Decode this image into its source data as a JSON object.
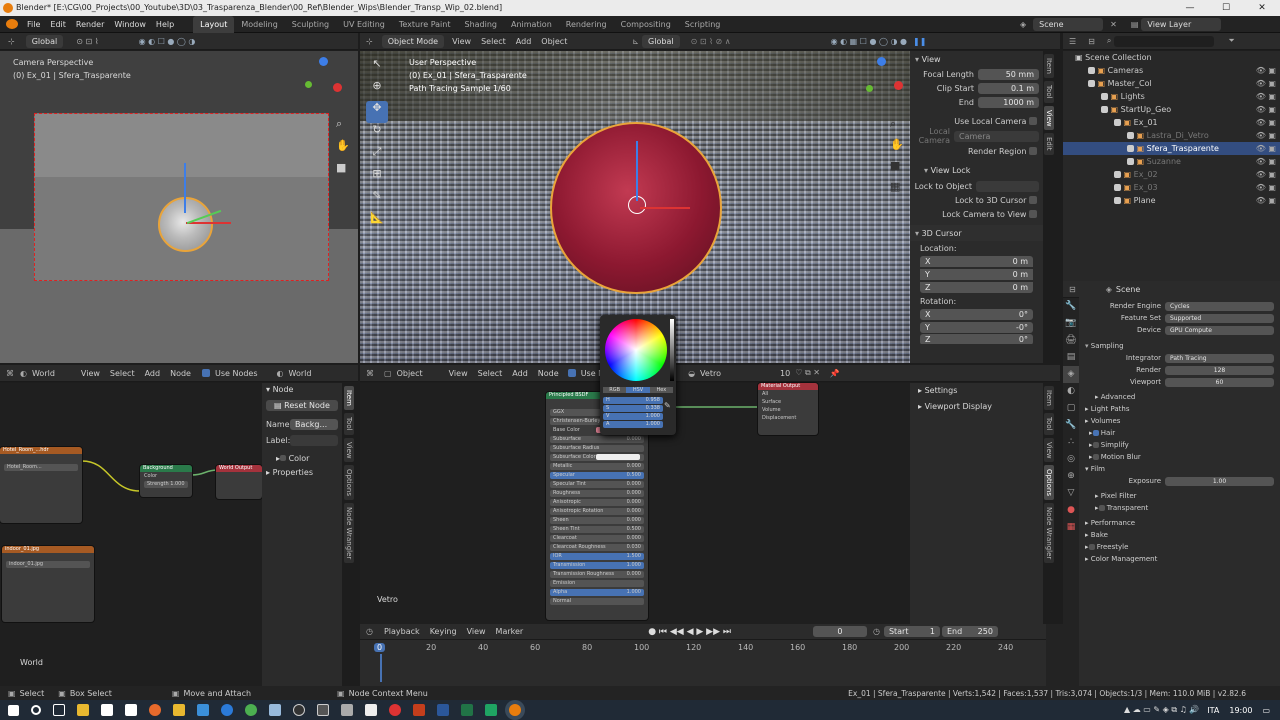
{
  "window": {
    "title": "Blender* [E:\\CG\\00_Projects\\00_Youtube\\3D\\03_Trasparenza_Blender\\00_Ref\\Blender_Wips\\Blender_Transp_Wip_02.blend]",
    "min": "—",
    "max": "☐",
    "close": "✕"
  },
  "menu": [
    "File",
    "Edit",
    "Render",
    "Window",
    "Help"
  ],
  "workspaces": [
    "Layout",
    "Modeling",
    "Sculpting",
    "UV Editing",
    "Texture Paint",
    "Shading",
    "Animation",
    "Rendering",
    "Compositing",
    "Scripting"
  ],
  "scene": {
    "label": "Scene",
    "view_layer": "View Layer"
  },
  "left_vp": {
    "orientation": "Global",
    "line1": "Camera Perspective",
    "line2": "(0) Ex_01 | Sfera_Trasparente"
  },
  "main_vp": {
    "mode": "Object Mode",
    "view": "View",
    "select": "Select",
    "add": "Add",
    "object": "Object",
    "orientation": "Global",
    "line1": "User Perspective",
    "line2": "(0) Ex_01 | Sfera_Trasparente",
    "line3": "Path Tracing Sample 1/60"
  },
  "nsidebar": {
    "view_title": "View",
    "focal_label": "Focal Length",
    "focal": "50 mm",
    "clip_start_label": "Clip Start",
    "clip_start": "0.1 m",
    "end_label": "End",
    "end": "1000 m",
    "local_cam": "Use Local Camera",
    "local_camera": "Local Camera",
    "camera": "Camera",
    "render_region": "Render Region",
    "view_lock": "View Lock",
    "lock_obj": "Lock to Object",
    "lock_cursor": "Lock to 3D Cursor",
    "lock_cam": "Lock Camera to View",
    "cursor_title": "3D Cursor",
    "location": "Location:",
    "x": "X",
    "y": "Y",
    "z": "Z",
    "loc_x": "0 m",
    "loc_y": "0 m",
    "loc_z": "0 m",
    "rotation": "Rotation:",
    "rot_x": "0°",
    "rot_y": "-0°",
    "rot_z": "0°"
  },
  "vtabs_main": [
    "Item",
    "Tool",
    "View",
    "Edit"
  ],
  "outliner": {
    "title": "Scene Collection",
    "items": [
      {
        "name": "Cameras",
        "indent": 1,
        "dim": false,
        "hl": false
      },
      {
        "name": "Master_Col",
        "indent": 1,
        "dim": false,
        "hl": false
      },
      {
        "name": "Lights",
        "indent": 2,
        "dim": false,
        "hl": false
      },
      {
        "name": "StartUp_Geo",
        "indent": 2,
        "dim": false,
        "hl": false
      },
      {
        "name": "Ex_01",
        "indent": 3,
        "dim": false,
        "hl": false
      },
      {
        "name": "Lastra_Di_Vetro",
        "indent": 4,
        "dim": true,
        "hl": false
      },
      {
        "name": "Sfera_Trasparente",
        "indent": 4,
        "dim": false,
        "hl": true
      },
      {
        "name": "Suzanne",
        "indent": 4,
        "dim": true,
        "hl": false
      },
      {
        "name": "Ex_02",
        "indent": 3,
        "dim": true,
        "hl": false
      },
      {
        "name": "Ex_03",
        "indent": 3,
        "dim": true,
        "hl": false
      },
      {
        "name": "Plane",
        "indent": 3,
        "dim": false,
        "hl": false
      }
    ]
  },
  "props": {
    "header": "Scene",
    "engine_label": "Render Engine",
    "engine": "Cycles",
    "feature_label": "Feature Set",
    "feature": "Supported",
    "device_label": "Device",
    "device": "GPU Compute",
    "sampling": "Sampling",
    "integrator_label": "Integrator",
    "integrator": "Path Tracing",
    "render_label": "Render",
    "render": "128",
    "viewport_label": "Viewport",
    "viewport": "60",
    "advanced": "Advanced",
    "light_paths": "Light Paths",
    "volumes": "Volumes",
    "hair": "Hair",
    "simplify": "Simplify",
    "motion_blur": "Motion Blur",
    "film": "Film",
    "exposure_label": "Exposure",
    "exposure": "1.00",
    "pixel_filter": "Pixel Filter",
    "transparent": "Transparent",
    "performance": "Performance",
    "bake": "Bake",
    "freestyle": "Freestyle",
    "color_mgmt": "Color Management"
  },
  "world_editor": {
    "type": "World",
    "view": "View",
    "select": "Select",
    "add": "Add",
    "node": "Node",
    "use_nodes": "Use Nodes",
    "world": "World",
    "footer": "World",
    "node_panel": "Node",
    "reset": "Reset Node",
    "name_label": "Name:",
    "name_value": "Backg...",
    "label_label": "Label:",
    "color": "Color",
    "properties": "Properties",
    "env_title": "Hotel_Room_...hdr",
    "env_label": "Hotel_Room...",
    "bg_title": "Background",
    "bg_color": "Color",
    "bg_strength": "Strength  1.000",
    "wout_title": "World Output",
    "img2_title": "indoor_01.jpg",
    "img2_label": "indoor_01.jpg"
  },
  "node_tabs": [
    "Item",
    "Tool",
    "View",
    "Options",
    "Node Wrangler"
  ],
  "shader_editor": {
    "object": "Object",
    "view": "View",
    "select": "Select",
    "add": "Add",
    "node": "Node",
    "use_nodes": "Use No",
    "material": "Vetro",
    "users": "10",
    "footer": "Vetro",
    "settings": "Settings",
    "viewport_display": "Viewport Display",
    "bsdf_title": "Principled BSDF",
    "bsdf_rows": [
      [
        "GGX",
        ""
      ],
      [
        "Christensen-Burley",
        ""
      ],
      [
        "Base Color",
        ""
      ],
      [
        "Subsurface",
        "0.000"
      ],
      [
        "Subsurface Radius",
        ""
      ],
      [
        "Subsurface Color",
        ""
      ],
      [
        "Metallic",
        "0.000"
      ],
      [
        "Specular",
        "0.500"
      ],
      [
        "Specular Tint",
        "0.000"
      ],
      [
        "Roughness",
        "0.000"
      ],
      [
        "Anisotropic",
        "0.000"
      ],
      [
        "Anisotropic Rotation",
        "0.000"
      ],
      [
        "Sheen",
        "0.000"
      ],
      [
        "Sheen Tint",
        "0.500"
      ],
      [
        "Clearcoat",
        "0.000"
      ],
      [
        "Clearcoat Roughness",
        "0.030"
      ],
      [
        "IOR",
        "1.500"
      ],
      [
        "Transmission",
        "1.000"
      ],
      [
        "Transmission Roughness",
        "0.000"
      ],
      [
        "Emission",
        ""
      ],
      [
        "Alpha",
        "1.000"
      ],
      [
        "Normal",
        ""
      ]
    ],
    "mout_title": "Material Output",
    "mout_rows": [
      "All",
      "Surface",
      "Volume",
      "Displacement"
    ],
    "picker_tabs": [
      "RGB",
      "HSV",
      "Hex"
    ],
    "picker_rows": [
      [
        "H",
        "0.958"
      ],
      [
        "S",
        "0.338"
      ],
      [
        "V",
        "1.000"
      ],
      [
        "A",
        "1.000"
      ]
    ]
  },
  "shader_tabs": [
    "Item",
    "Tool",
    "View",
    "Options",
    "Node Wrangler"
  ],
  "timeline": {
    "playback": "Playback",
    "keying": "Keying",
    "view": "View",
    "marker": "Marker",
    "frame": "0",
    "start_label": "Start",
    "start": "1",
    "end_label": "End",
    "end": "250",
    "ticks": [
      "0",
      "20",
      "40",
      "60",
      "80",
      "100",
      "120",
      "140",
      "160",
      "180",
      "200",
      "220",
      "240"
    ]
  },
  "status": {
    "select": "Select",
    "box": "Box Select",
    "move": "Move and Attach",
    "context": "Node Context Menu",
    "info": "Ex_01 | Sfera_Trasparente | Verts:1,542 | Faces:1,537 | Tris:3,074 | Objects:1/3 | Mem: 110.0 MiB | v2.82.6"
  },
  "taskbar": {
    "lang": "ITA",
    "time": "19:00"
  },
  "colors": {
    "accent": "#4772b3",
    "orange": "#e87d0d",
    "selection": "#334d80",
    "base_color": "#f28ca0"
  }
}
